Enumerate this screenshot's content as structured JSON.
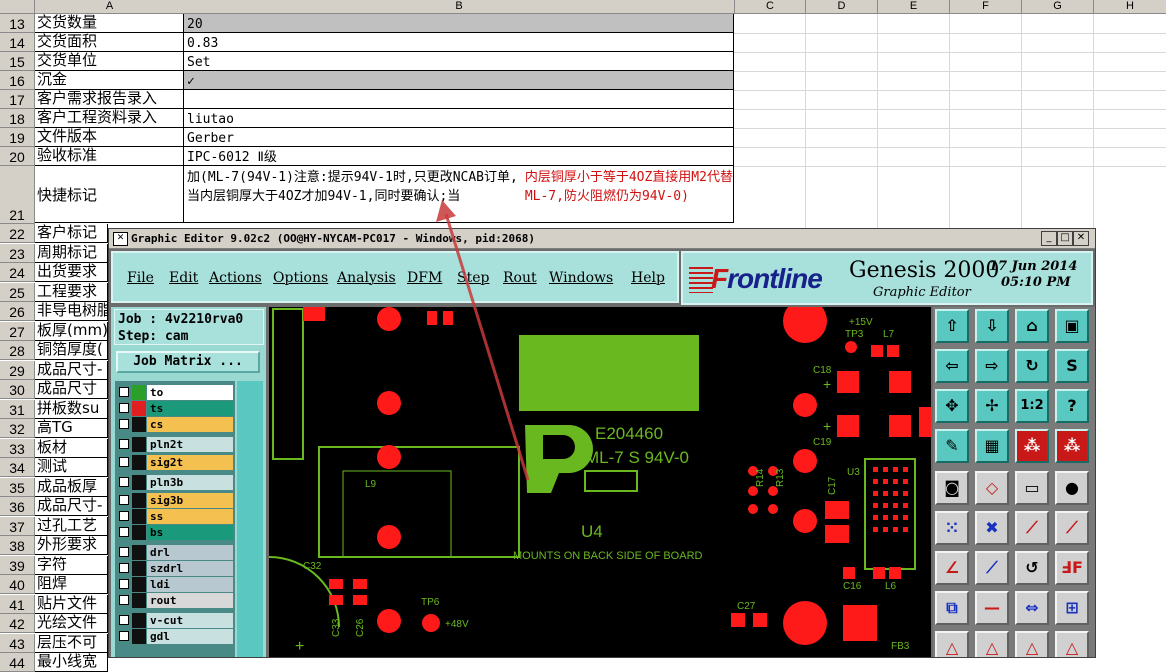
{
  "sheet": {
    "columns": [
      "A",
      "B",
      "C",
      "D",
      "E",
      "F",
      "G",
      "H"
    ],
    "rows": [
      {
        "n": "13",
        "a": "交货数量",
        "b": "20",
        "gray": true
      },
      {
        "n": "14",
        "a": "交货面积",
        "b": "0.83",
        "gray": false
      },
      {
        "n": "15",
        "a": "交货单位",
        "b": "Set",
        "gray": false
      },
      {
        "n": "16",
        "a": "沉金",
        "b": "✓",
        "gray": true
      },
      {
        "n": "17",
        "a": "客户需求报告录入",
        "b": "",
        "gray": false
      },
      {
        "n": "18",
        "a": "客户工程资料录入",
        "b": "liutao",
        "gray": false
      },
      {
        "n": "19",
        "a": "文件版本",
        "b": "Gerber",
        "gray": false
      },
      {
        "n": "20",
        "a": "验收标准",
        "b": "IPC-6012 Ⅱ级",
        "gray": false
      }
    ],
    "row21": {
      "n": "21",
      "a": "快捷标记",
      "b_black": "加(ML-7(94V-1)注意:提示94V-1时,只更改NCAB订单,当内层铜厚大于4OZ才加94V-1,同时要确认;当",
      "b_red": "内层铜厚小于等于4OZ直接用M2代替ML-7,防火阻燃仍为94V-0)"
    },
    "lower_rows": [
      {
        "n": "22",
        "a": "客户标记"
      },
      {
        "n": "23",
        "a": "周期标记"
      },
      {
        "n": "24",
        "a": "出货要求"
      },
      {
        "n": "25",
        "a": "工程要求"
      },
      {
        "n": "26",
        "a": "非导电树脂"
      },
      {
        "n": "27",
        "a": "板厚(mm)"
      },
      {
        "n": "28",
        "a": "铜箔厚度("
      },
      {
        "n": "29",
        "a": "成品尺寸-"
      },
      {
        "n": "30",
        "a": "成品尺寸"
      },
      {
        "n": "31",
        "a": "拼板数su"
      },
      {
        "n": "32",
        "a": "高TG"
      },
      {
        "n": "33",
        "a": "板材"
      },
      {
        "n": "34",
        "a": "测试"
      },
      {
        "n": "35",
        "a": "成品板厚"
      },
      {
        "n": "36",
        "a": "成品尺寸-"
      },
      {
        "n": "37",
        "a": "过孔工艺"
      },
      {
        "n": "38",
        "a": "外形要求"
      },
      {
        "n": "39",
        "a": "字符"
      },
      {
        "n": "40",
        "a": "阻焊"
      },
      {
        "n": "41",
        "a": "贴片文件"
      },
      {
        "n": "42",
        "a": "光绘文件"
      },
      {
        "n": "43",
        "a": "层压不可"
      },
      {
        "n": "44",
        "a": "最小线宽"
      }
    ]
  },
  "genesis": {
    "title": "Graphic Editor 9.02c2 (OO@HY-NYCAM-PC017 - Windows, pid:2068)",
    "menu": [
      "File",
      "Edit",
      "Actions",
      "Options",
      "Analysis",
      "DFM",
      "Step",
      "Rout",
      "Windows",
      "Help"
    ],
    "brand": {
      "logo_front": "F",
      "logo_rest": "rontline",
      "product": "Genesis 2000",
      "subtitle": "Graphic Editor",
      "date": "17 Jun 2014",
      "time": "05:10 PM"
    },
    "job": "Job : 4v2210rva0",
    "step": "Step: cam",
    "job_matrix_button": "Job Matrix ...",
    "layers": [
      {
        "name": "to",
        "color": "#ffffff",
        "swatch": "#2aa02a"
      },
      {
        "name": "ts",
        "color": "#1a9a7a",
        "swatch": "#e02020"
      },
      {
        "name": "cs",
        "color": "#f4c050",
        "swatch": "#101010"
      },
      {
        "name": "pln2t",
        "color": "#c8e0e0",
        "swatch": "#101010"
      },
      {
        "name": "sig2t",
        "color": "#f4c050",
        "swatch": "#101010"
      },
      {
        "name": "pln3b",
        "color": "#c8e0e0",
        "swatch": "#101010"
      },
      {
        "name": "sig3b",
        "color": "#f4c050",
        "swatch": "#101010"
      },
      {
        "name": "ss",
        "color": "#f4c050",
        "swatch": "#101010"
      },
      {
        "name": "bs",
        "color": "#1a9a7a",
        "swatch": "#101010"
      },
      {
        "name": "drl",
        "color": "#b8c8d0",
        "swatch": "#101010"
      },
      {
        "name": "szdrl",
        "color": "#b8c8d0",
        "swatch": "#101010"
      },
      {
        "name": "ldi",
        "color": "#b8c8d0",
        "swatch": "#101010"
      },
      {
        "name": "rout",
        "color": "#d8d8d8",
        "swatch": "#101010"
      },
      {
        "name": "v-cut",
        "color": "#c8e0e0",
        "swatch": "#101010"
      },
      {
        "name": "gdl",
        "color": "#c8e0e0",
        "swatch": "#101010"
      }
    ],
    "board_text": {
      "ul": "E204460",
      "mat": "ML-7 S 94V-0",
      "u4": "U4",
      "mount": "MOUNTS ON BACK SIDE OF BOARD",
      "labels": [
        "+15V",
        "TP3",
        "L7",
        "C18",
        "C19",
        "R14",
        "R13",
        "U3",
        "C17",
        "L9",
        "C32",
        "C33",
        "C26",
        "TP6",
        "+48V",
        "C27",
        "C16",
        "L6",
        "FB3"
      ]
    },
    "colors": {
      "pad": "#ff1a1a",
      "silk": "#6ab820",
      "cyan": "#a8e0dc"
    }
  }
}
